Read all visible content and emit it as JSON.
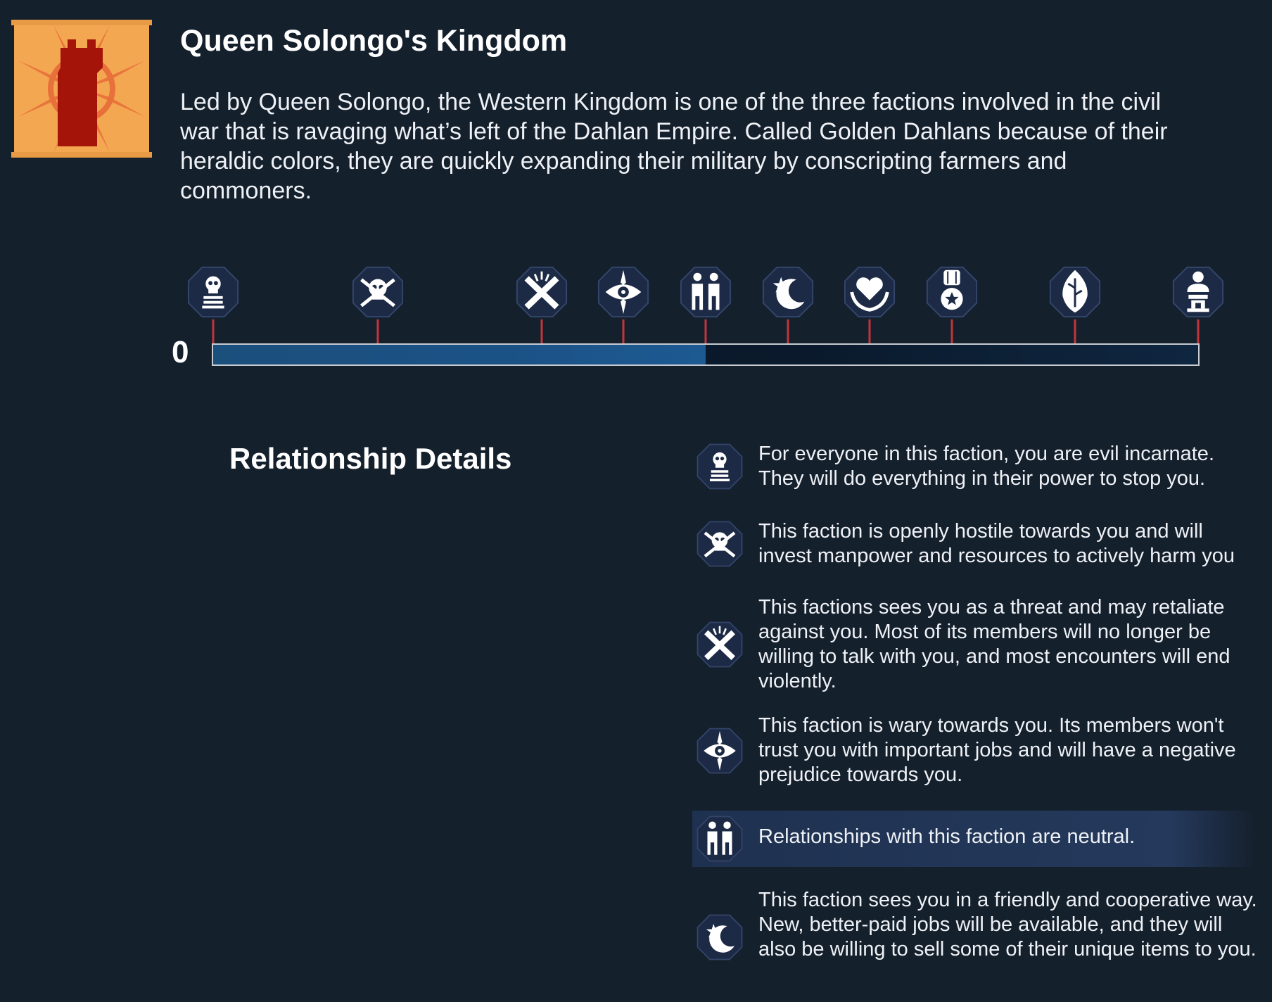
{
  "faction": {
    "name": "Queen Solongo's Kingdom",
    "description": "Led by Queen Solongo, the Western Kingdom is one of the three factions involved in the civil war that is ravaging what’s left of the Dahlan Empire. Called Golden Dahlans because of their heraldic colors, they are quickly expanding their military by conscripting farmers and commoners.",
    "banner_icon": "castle-tower-sun-banner",
    "colors": {
      "banner_bg": "#f0a04a",
      "tower": "#a41408",
      "accent_tick": "#c2353a"
    }
  },
  "relationship": {
    "score": "0",
    "progress_fraction": 0.5,
    "tiers": [
      {
        "icon": "skull-pillar-icon"
      },
      {
        "icon": "skull-crossbones-icon"
      },
      {
        "icon": "crossed-swords-icon"
      },
      {
        "icon": "eye-compass-icon"
      },
      {
        "icon": "two-people-icon"
      },
      {
        "icon": "moon-star-icon"
      },
      {
        "icon": "heart-hands-icon"
      },
      {
        "icon": "medal-icon"
      },
      {
        "icon": "leaf-shield-icon"
      },
      {
        "icon": "bust-statue-icon"
      }
    ]
  },
  "details": {
    "title": "Relationship Details",
    "items": [
      {
        "icon": "skull-pillar-icon",
        "text": "For everyone in this faction, you are evil incarnate. They will do everything in their power to stop you.",
        "active": false
      },
      {
        "icon": "skull-crossbones-icon",
        "text": "This faction is openly hostile towards you and will invest manpower and resources to actively harm you",
        "active": false
      },
      {
        "icon": "crossed-swords-icon",
        "text": "This factions sees you as a threat and may retaliate against you. Most of its members will no longer be willing to talk with you, and most encounters will end violently.",
        "active": false
      },
      {
        "icon": "eye-compass-icon",
        "text": "This faction is wary towards you. Its members won't trust you with important jobs and will have a negative prejudice towards you.",
        "active": false
      },
      {
        "icon": "two-people-icon",
        "text": "Relationships with this faction are neutral.",
        "active": true
      },
      {
        "icon": "moon-star-icon",
        "text": "This faction sees you in a friendly and cooperative way. New, better-paid jobs will be available, and they will also be willing to sell some of their unique items to you.",
        "active": false
      }
    ]
  }
}
